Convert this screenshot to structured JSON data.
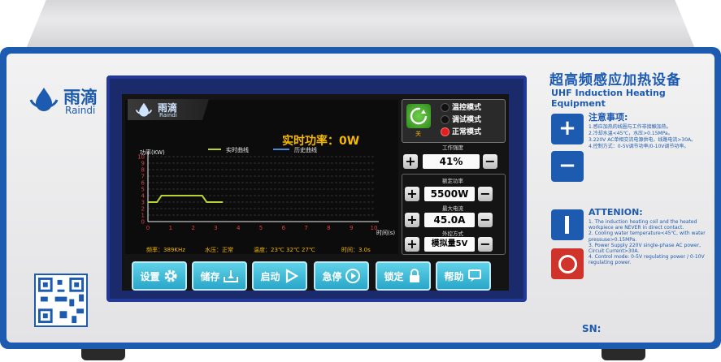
{
  "brand": {
    "cn": "雨滴",
    "en": "Raindi"
  },
  "device": {
    "title_cn": "超高频感应加热设备",
    "title_en": "UHF Induction Heating Equipment",
    "notes_title": "注意事项:",
    "notes": [
      "1.感应加热的线圈与工作非接触加热。",
      "2.冷却水温<45℃，水压>0.15MPa。",
      "3.220V AC单相交流电源供电，线路电流>30A。",
      "4.控制方式：0-5V调节功率/0-10V调节功率。"
    ],
    "attention_title": "ATTENION:",
    "attention": [
      "1. The induction heating coil and the heated workpiece are NEVER in direct contact.",
      "2. Cooling water temperature<45℃, with water pressuse>0.15MPa.",
      "3. Power Supply 220V single-phase AC power, Circuit Current>30A.",
      "4. Control mode: 0-5V regulating power / 0-10V regulating power."
    ],
    "sn_label": "SN:",
    "plus_label": "+",
    "minus_label": "−",
    "power_on_label": "I",
    "power_off_label": "O"
  },
  "screen": {
    "logo_cn": "雨滴",
    "logo_en": "Raindi",
    "title": "实时功率：0W",
    "ylabel": "功率(KW)",
    "xlabel": "时间(s)",
    "legend": [
      {
        "label": "实时曲线",
        "color": "#b5d335"
      },
      {
        "label": "历史曲线",
        "color": "#4a8ad8"
      }
    ],
    "status": {
      "freq": "频率：389KHz",
      "water": "水压：正常",
      "temp": "温度：23℃ 32℃ 27℃",
      "time": "时间：3.0s"
    },
    "ok_label": "关",
    "modes": [
      {
        "label": "温控模式",
        "active": false
      },
      {
        "label": "调试模式",
        "active": false
      },
      {
        "label": "正常模式",
        "active": true
      }
    ],
    "work_strength": {
      "title": "工作强度",
      "value": "41%"
    },
    "rated_power": {
      "title": "额定功率",
      "value": "5500W"
    },
    "max_current": {
      "title": "最大电流",
      "value": "45.0A"
    },
    "external_control": {
      "title": "外控方式",
      "value": "模拟量5V"
    },
    "buttons": [
      {
        "label": "设置",
        "icon": "gear-icon"
      },
      {
        "label": "储存",
        "icon": "save-tray-icon"
      },
      {
        "label": "启动",
        "icon": "play-icon"
      },
      {
        "label": "急停",
        "icon": "stop-play-icon"
      },
      {
        "label": "锁定",
        "icon": "lock-icon"
      },
      {
        "label": "帮助",
        "icon": "help-chat-icon"
      }
    ]
  },
  "chart_data": {
    "type": "line",
    "title": "实时功率：0W",
    "xlabel": "时间(s)",
    "ylabel": "功率(KW)",
    "x_ticks": [
      0,
      1,
      2,
      3,
      4,
      5,
      6,
      7,
      8,
      9,
      10
    ],
    "y_ticks": [
      0,
      1,
      2,
      3,
      4,
      5,
      6,
      7,
      8,
      9,
      10
    ],
    "xlim": [
      0,
      10
    ],
    "ylim": [
      0,
      10
    ],
    "grid": true,
    "series": [
      {
        "name": "实时曲线",
        "color": "#b5d335",
        "x": [
          0,
          0.4,
          0.6,
          2.4,
          2.6,
          3.3
        ],
        "y": [
          3,
          3,
          4,
          4,
          3,
          3
        ]
      },
      {
        "name": "历史曲线",
        "color": "#4a8ad8",
        "x": [],
        "y": []
      }
    ]
  }
}
